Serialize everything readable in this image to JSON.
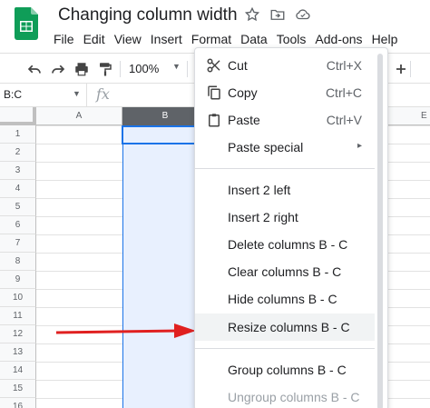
{
  "app": {
    "title": "Changing column width"
  },
  "menu": [
    "File",
    "Edit",
    "View",
    "Insert",
    "Format",
    "Data",
    "Tools",
    "Add-ons",
    "Help"
  ],
  "toolbar": {
    "zoom": "100%"
  },
  "formula": {
    "name_box": "B:C",
    "fx": "fx"
  },
  "grid": {
    "columns": [
      {
        "label": "A",
        "selected": false
      },
      {
        "label": "B",
        "selected": true
      },
      {
        "label": "E",
        "selected": false
      }
    ],
    "rows": [
      "1",
      "2",
      "3",
      "4",
      "5",
      "6",
      "7",
      "8",
      "9",
      "10",
      "11",
      "12",
      "13",
      "14",
      "15",
      "16"
    ]
  },
  "context_menu": {
    "items": [
      {
        "label": "Cut",
        "shortcut": "Ctrl+X",
        "icon": "scissors-icon"
      },
      {
        "label": "Copy",
        "shortcut": "Ctrl+C",
        "icon": "copy-icon"
      },
      {
        "label": "Paste",
        "shortcut": "Ctrl+V",
        "icon": "clipboard-icon"
      },
      {
        "label": "Paste special",
        "submenu": "▸"
      },
      {
        "label": "Insert 2 left"
      },
      {
        "label": "Insert 2 right"
      },
      {
        "label": "Delete columns B - C"
      },
      {
        "label": "Clear columns B - C"
      },
      {
        "label": "Hide columns B - C"
      },
      {
        "label": "Resize columns B - C"
      },
      {
        "label": "Group columns B - C"
      },
      {
        "label": "Ungroup columns B - C"
      }
    ]
  },
  "colors": {
    "accent": "#1a73e8",
    "selection_fill": "#e8f0fe",
    "arrow": "#e02020",
    "sheets_green": "#0f9d58"
  }
}
